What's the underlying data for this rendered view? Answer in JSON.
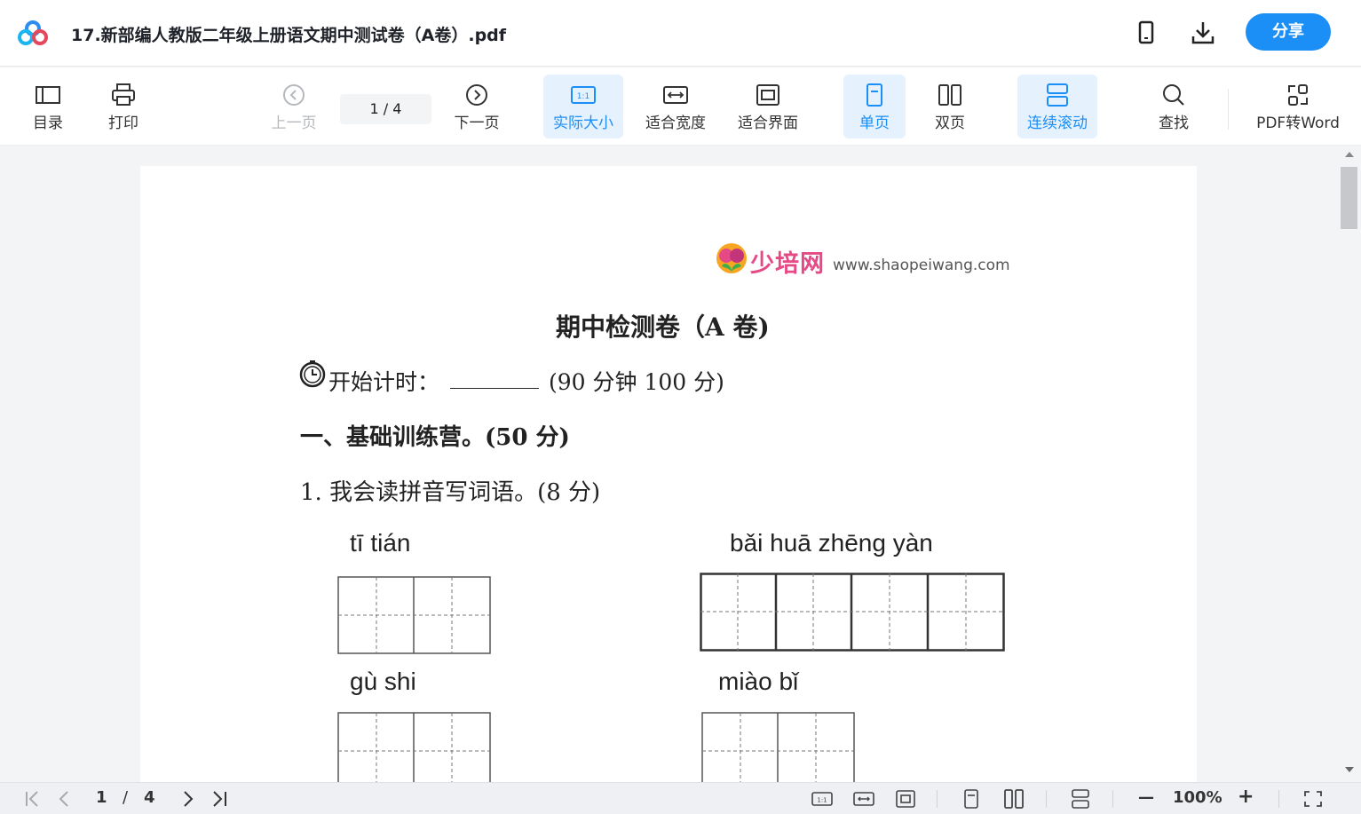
{
  "titlebar": {
    "title": "17.新部编人教版二年级上册语文期中测试卷（A卷）.pdf",
    "share_label": "分享",
    "icons": [
      "app-logo-icon",
      "mobile-icon",
      "download-icon"
    ]
  },
  "toolbar": {
    "toc": "目录",
    "print": "打印",
    "prev": "上一页",
    "page_indicator": "1  /  4",
    "next": "下一页",
    "actual_size": "实际大小",
    "fit_width": "适合宽度",
    "fit_page": "适合界面",
    "single": "单页",
    "double": "双页",
    "continuous": "连续滚动",
    "find": "查找",
    "pdf_to_word": "PDF转Word"
  },
  "document": {
    "watermark_brand": "少培网",
    "watermark_url": "www.shaopeiwang.com",
    "heading": "期中检测卷（A 卷)",
    "timer_label": "开始计时：",
    "timer_blank": "________",
    "timer_detail": "(90 分钟    100 分)",
    "section1": "一、基础训练营。(50 分)",
    "q1": "1.  我会读拼音写词语。(8 分)",
    "words": [
      {
        "pinyin": "tī tián",
        "boxes": 2
      },
      {
        "pinyin": "bǎi  huā   zhēng  yàn",
        "boxes": 4
      },
      {
        "pinyin": "gù    shi",
        "boxes": 2
      },
      {
        "pinyin": "miào    bǐ",
        "boxes": 2
      }
    ]
  },
  "statusbar": {
    "current_page": "1",
    "separator": "/",
    "total_pages": "4",
    "zoom": "100%",
    "zoom_minus": "—",
    "zoom_plus": "+"
  }
}
